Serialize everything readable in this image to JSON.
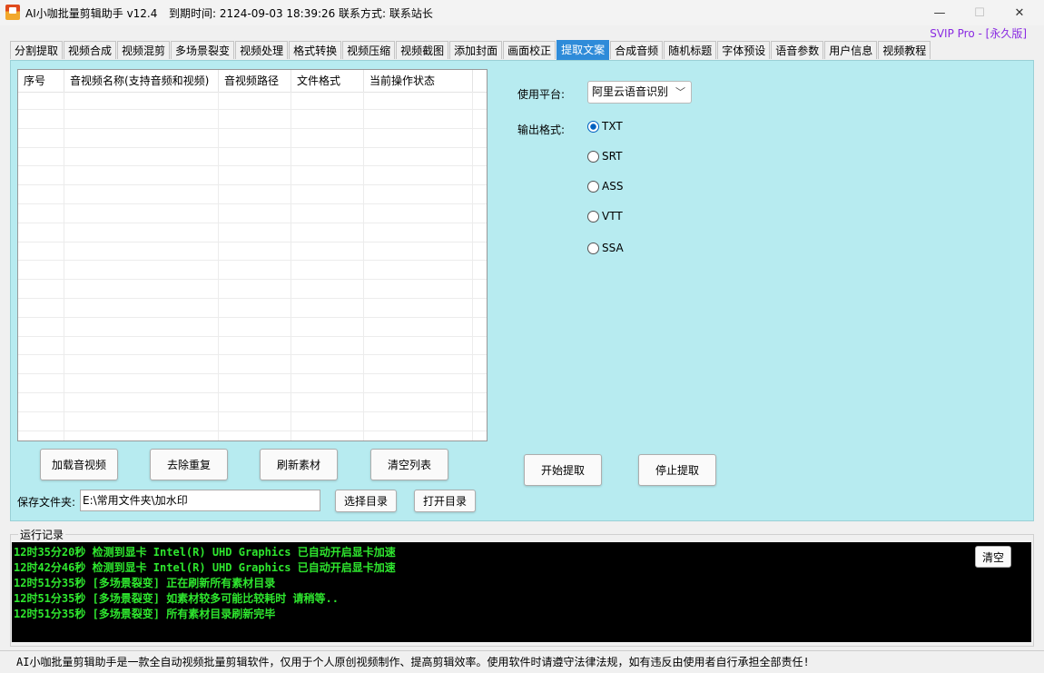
{
  "window": {
    "title": "AI小咖批量剪辑助手 v12.4",
    "expiry": "到期时间: 2124-09-03 18:39:26",
    "contact": "联系方式: 联系站长",
    "minimize": "—",
    "maximize": "☐",
    "close": "✕",
    "badge": "SVIP Pro - [永久版]"
  },
  "tabs": [
    {
      "label": "分割提取"
    },
    {
      "label": "视频合成"
    },
    {
      "label": "视频混剪"
    },
    {
      "label": "多场景裂变"
    },
    {
      "label": "视频处理"
    },
    {
      "label": "格式转换"
    },
    {
      "label": "视频压缩"
    },
    {
      "label": "视频截图"
    },
    {
      "label": "添加封面"
    },
    {
      "label": "画面校正"
    },
    {
      "label": "提取文案",
      "active": true
    },
    {
      "label": "合成音频"
    },
    {
      "label": "随机标题"
    },
    {
      "label": "字体预设"
    },
    {
      "label": "语音参数"
    },
    {
      "label": "用户信息"
    },
    {
      "label": "视频教程"
    }
  ],
  "table": {
    "columns": [
      "序号",
      "音视频名称(支持音频和视频)",
      "音视频路径",
      "文件格式",
      "当前操作状态"
    ]
  },
  "buttons": {
    "load": "加载音视频",
    "dedupe": "去除重复",
    "refresh": "刷新素材",
    "clear_list": "清空列表",
    "choose_dir": "选择目录",
    "open_dir": "打开目录",
    "start": "开始提取",
    "stop": "停止提取",
    "clear_log": "清空"
  },
  "save": {
    "label": "保存文件夹:",
    "path": "E:\\常用文件夹\\加水印"
  },
  "settings": {
    "platform_label": "使用平台:",
    "platform_value": "阿里云语音识别",
    "format_label": "输出格式:",
    "formats": [
      "TXT",
      "SRT",
      "ASS",
      "VTT",
      "SSA"
    ],
    "selected_format": "TXT"
  },
  "log": {
    "title": "运行记录",
    "lines": [
      "12时35分20秒 检测到显卡 Intel(R) UHD Graphics 已自动开启显卡加速",
      "12时42分46秒 检测到显卡 Intel(R) UHD Graphics 已自动开启显卡加速",
      "12时51分35秒 [多场景裂变] 正在刷新所有素材目录",
      "12时51分35秒 [多场景裂变] 如素材较多可能比较耗时 请稍等..",
      "12时51分35秒 [多场景裂变] 所有素材目录刷新完毕"
    ]
  },
  "status": {
    "text": "AI小咖批量剪辑助手是一款全自动视频批量剪辑软件，仅用于个人原创视频制作、提高剪辑效率。使用软件时请遵守法律法规，如有违反由使用者自行承担全部责任!"
  },
  "colors": {
    "panel_bg": "#b7ebf0",
    "active_tab": "#2e8bd9",
    "log_text": "#2ee62e",
    "badge": "#8a2be2"
  }
}
